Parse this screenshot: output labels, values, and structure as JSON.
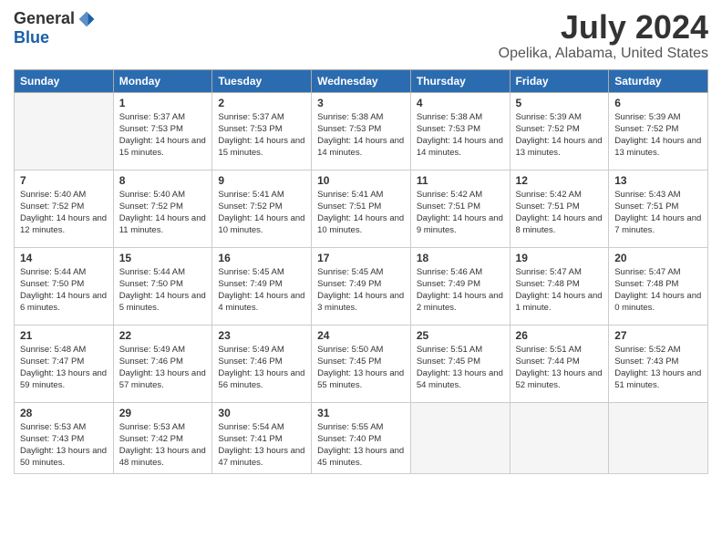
{
  "header": {
    "logo_general": "General",
    "logo_blue": "Blue",
    "month_title": "July 2024",
    "location": "Opelika, Alabama, United States"
  },
  "weekdays": [
    "Sunday",
    "Monday",
    "Tuesday",
    "Wednesday",
    "Thursday",
    "Friday",
    "Saturday"
  ],
  "weeks": [
    [
      {
        "day": "",
        "info": ""
      },
      {
        "day": "1",
        "info": "Sunrise: 5:37 AM\nSunset: 7:53 PM\nDaylight: 14 hours\nand 15 minutes."
      },
      {
        "day": "2",
        "info": "Sunrise: 5:37 AM\nSunset: 7:53 PM\nDaylight: 14 hours\nand 15 minutes."
      },
      {
        "day": "3",
        "info": "Sunrise: 5:38 AM\nSunset: 7:53 PM\nDaylight: 14 hours\nand 14 minutes."
      },
      {
        "day": "4",
        "info": "Sunrise: 5:38 AM\nSunset: 7:53 PM\nDaylight: 14 hours\nand 14 minutes."
      },
      {
        "day": "5",
        "info": "Sunrise: 5:39 AM\nSunset: 7:52 PM\nDaylight: 14 hours\nand 13 minutes."
      },
      {
        "day": "6",
        "info": "Sunrise: 5:39 AM\nSunset: 7:52 PM\nDaylight: 14 hours\nand 13 minutes."
      }
    ],
    [
      {
        "day": "7",
        "info": "Sunrise: 5:40 AM\nSunset: 7:52 PM\nDaylight: 14 hours\nand 12 minutes."
      },
      {
        "day": "8",
        "info": "Sunrise: 5:40 AM\nSunset: 7:52 PM\nDaylight: 14 hours\nand 11 minutes."
      },
      {
        "day": "9",
        "info": "Sunrise: 5:41 AM\nSunset: 7:52 PM\nDaylight: 14 hours\nand 10 minutes."
      },
      {
        "day": "10",
        "info": "Sunrise: 5:41 AM\nSunset: 7:51 PM\nDaylight: 14 hours\nand 10 minutes."
      },
      {
        "day": "11",
        "info": "Sunrise: 5:42 AM\nSunset: 7:51 PM\nDaylight: 14 hours\nand 9 minutes."
      },
      {
        "day": "12",
        "info": "Sunrise: 5:42 AM\nSunset: 7:51 PM\nDaylight: 14 hours\nand 8 minutes."
      },
      {
        "day": "13",
        "info": "Sunrise: 5:43 AM\nSunset: 7:51 PM\nDaylight: 14 hours\nand 7 minutes."
      }
    ],
    [
      {
        "day": "14",
        "info": "Sunrise: 5:44 AM\nSunset: 7:50 PM\nDaylight: 14 hours\nand 6 minutes."
      },
      {
        "day": "15",
        "info": "Sunrise: 5:44 AM\nSunset: 7:50 PM\nDaylight: 14 hours\nand 5 minutes."
      },
      {
        "day": "16",
        "info": "Sunrise: 5:45 AM\nSunset: 7:49 PM\nDaylight: 14 hours\nand 4 minutes."
      },
      {
        "day": "17",
        "info": "Sunrise: 5:45 AM\nSunset: 7:49 PM\nDaylight: 14 hours\nand 3 minutes."
      },
      {
        "day": "18",
        "info": "Sunrise: 5:46 AM\nSunset: 7:49 PM\nDaylight: 14 hours\nand 2 minutes."
      },
      {
        "day": "19",
        "info": "Sunrise: 5:47 AM\nSunset: 7:48 PM\nDaylight: 14 hours\nand 1 minute."
      },
      {
        "day": "20",
        "info": "Sunrise: 5:47 AM\nSunset: 7:48 PM\nDaylight: 14 hours\nand 0 minutes."
      }
    ],
    [
      {
        "day": "21",
        "info": "Sunrise: 5:48 AM\nSunset: 7:47 PM\nDaylight: 13 hours\nand 59 minutes."
      },
      {
        "day": "22",
        "info": "Sunrise: 5:49 AM\nSunset: 7:46 PM\nDaylight: 13 hours\nand 57 minutes."
      },
      {
        "day": "23",
        "info": "Sunrise: 5:49 AM\nSunset: 7:46 PM\nDaylight: 13 hours\nand 56 minutes."
      },
      {
        "day": "24",
        "info": "Sunrise: 5:50 AM\nSunset: 7:45 PM\nDaylight: 13 hours\nand 55 minutes."
      },
      {
        "day": "25",
        "info": "Sunrise: 5:51 AM\nSunset: 7:45 PM\nDaylight: 13 hours\nand 54 minutes."
      },
      {
        "day": "26",
        "info": "Sunrise: 5:51 AM\nSunset: 7:44 PM\nDaylight: 13 hours\nand 52 minutes."
      },
      {
        "day": "27",
        "info": "Sunrise: 5:52 AM\nSunset: 7:43 PM\nDaylight: 13 hours\nand 51 minutes."
      }
    ],
    [
      {
        "day": "28",
        "info": "Sunrise: 5:53 AM\nSunset: 7:43 PM\nDaylight: 13 hours\nand 50 minutes."
      },
      {
        "day": "29",
        "info": "Sunrise: 5:53 AM\nSunset: 7:42 PM\nDaylight: 13 hours\nand 48 minutes."
      },
      {
        "day": "30",
        "info": "Sunrise: 5:54 AM\nSunset: 7:41 PM\nDaylight: 13 hours\nand 47 minutes."
      },
      {
        "day": "31",
        "info": "Sunrise: 5:55 AM\nSunset: 7:40 PM\nDaylight: 13 hours\nand 45 minutes."
      },
      {
        "day": "",
        "info": ""
      },
      {
        "day": "",
        "info": ""
      },
      {
        "day": "",
        "info": ""
      }
    ]
  ]
}
